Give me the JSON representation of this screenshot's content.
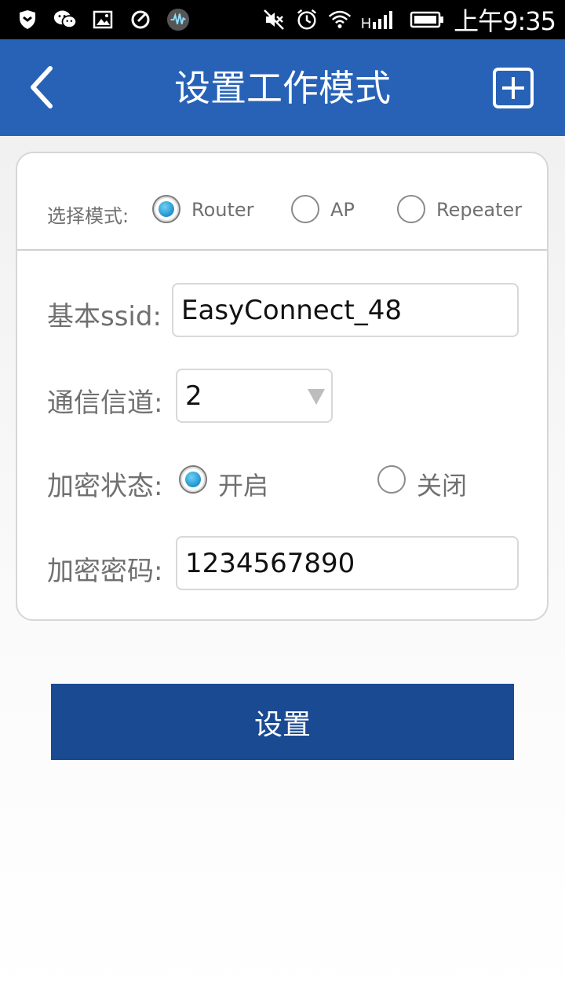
{
  "status_bar": {
    "time": "上午9:35",
    "left_icons": [
      "shield-icon",
      "wechat-icon",
      "image-icon",
      "clean-icon",
      "audio-app-icon"
    ],
    "right_icons": [
      "mute-icon",
      "alarm-icon",
      "wifi-icon",
      "signal-icon",
      "battery-icon"
    ]
  },
  "header": {
    "title": "设置工作模式",
    "back_icon": "chevron-left-icon",
    "add_icon": "plus-square-icon"
  },
  "mode": {
    "label": "选择模式:",
    "options": [
      "Router",
      "AP",
      "Repeater"
    ],
    "selected": "Router"
  },
  "ssid": {
    "label": "基本ssid:",
    "value": "EasyConnect_48"
  },
  "channel": {
    "label": "通信信道:",
    "value": "2"
  },
  "encryption": {
    "label": "加密状态:",
    "options": [
      "开启",
      "关闭"
    ],
    "selected": "开启"
  },
  "password": {
    "label": "加密密码:",
    "value": "1234567890"
  },
  "submit": {
    "label": "设置"
  },
  "colors": {
    "header_bg": "#2762b7",
    "button_bg": "#1a4a92",
    "radio_accent": "#1e93cf"
  }
}
